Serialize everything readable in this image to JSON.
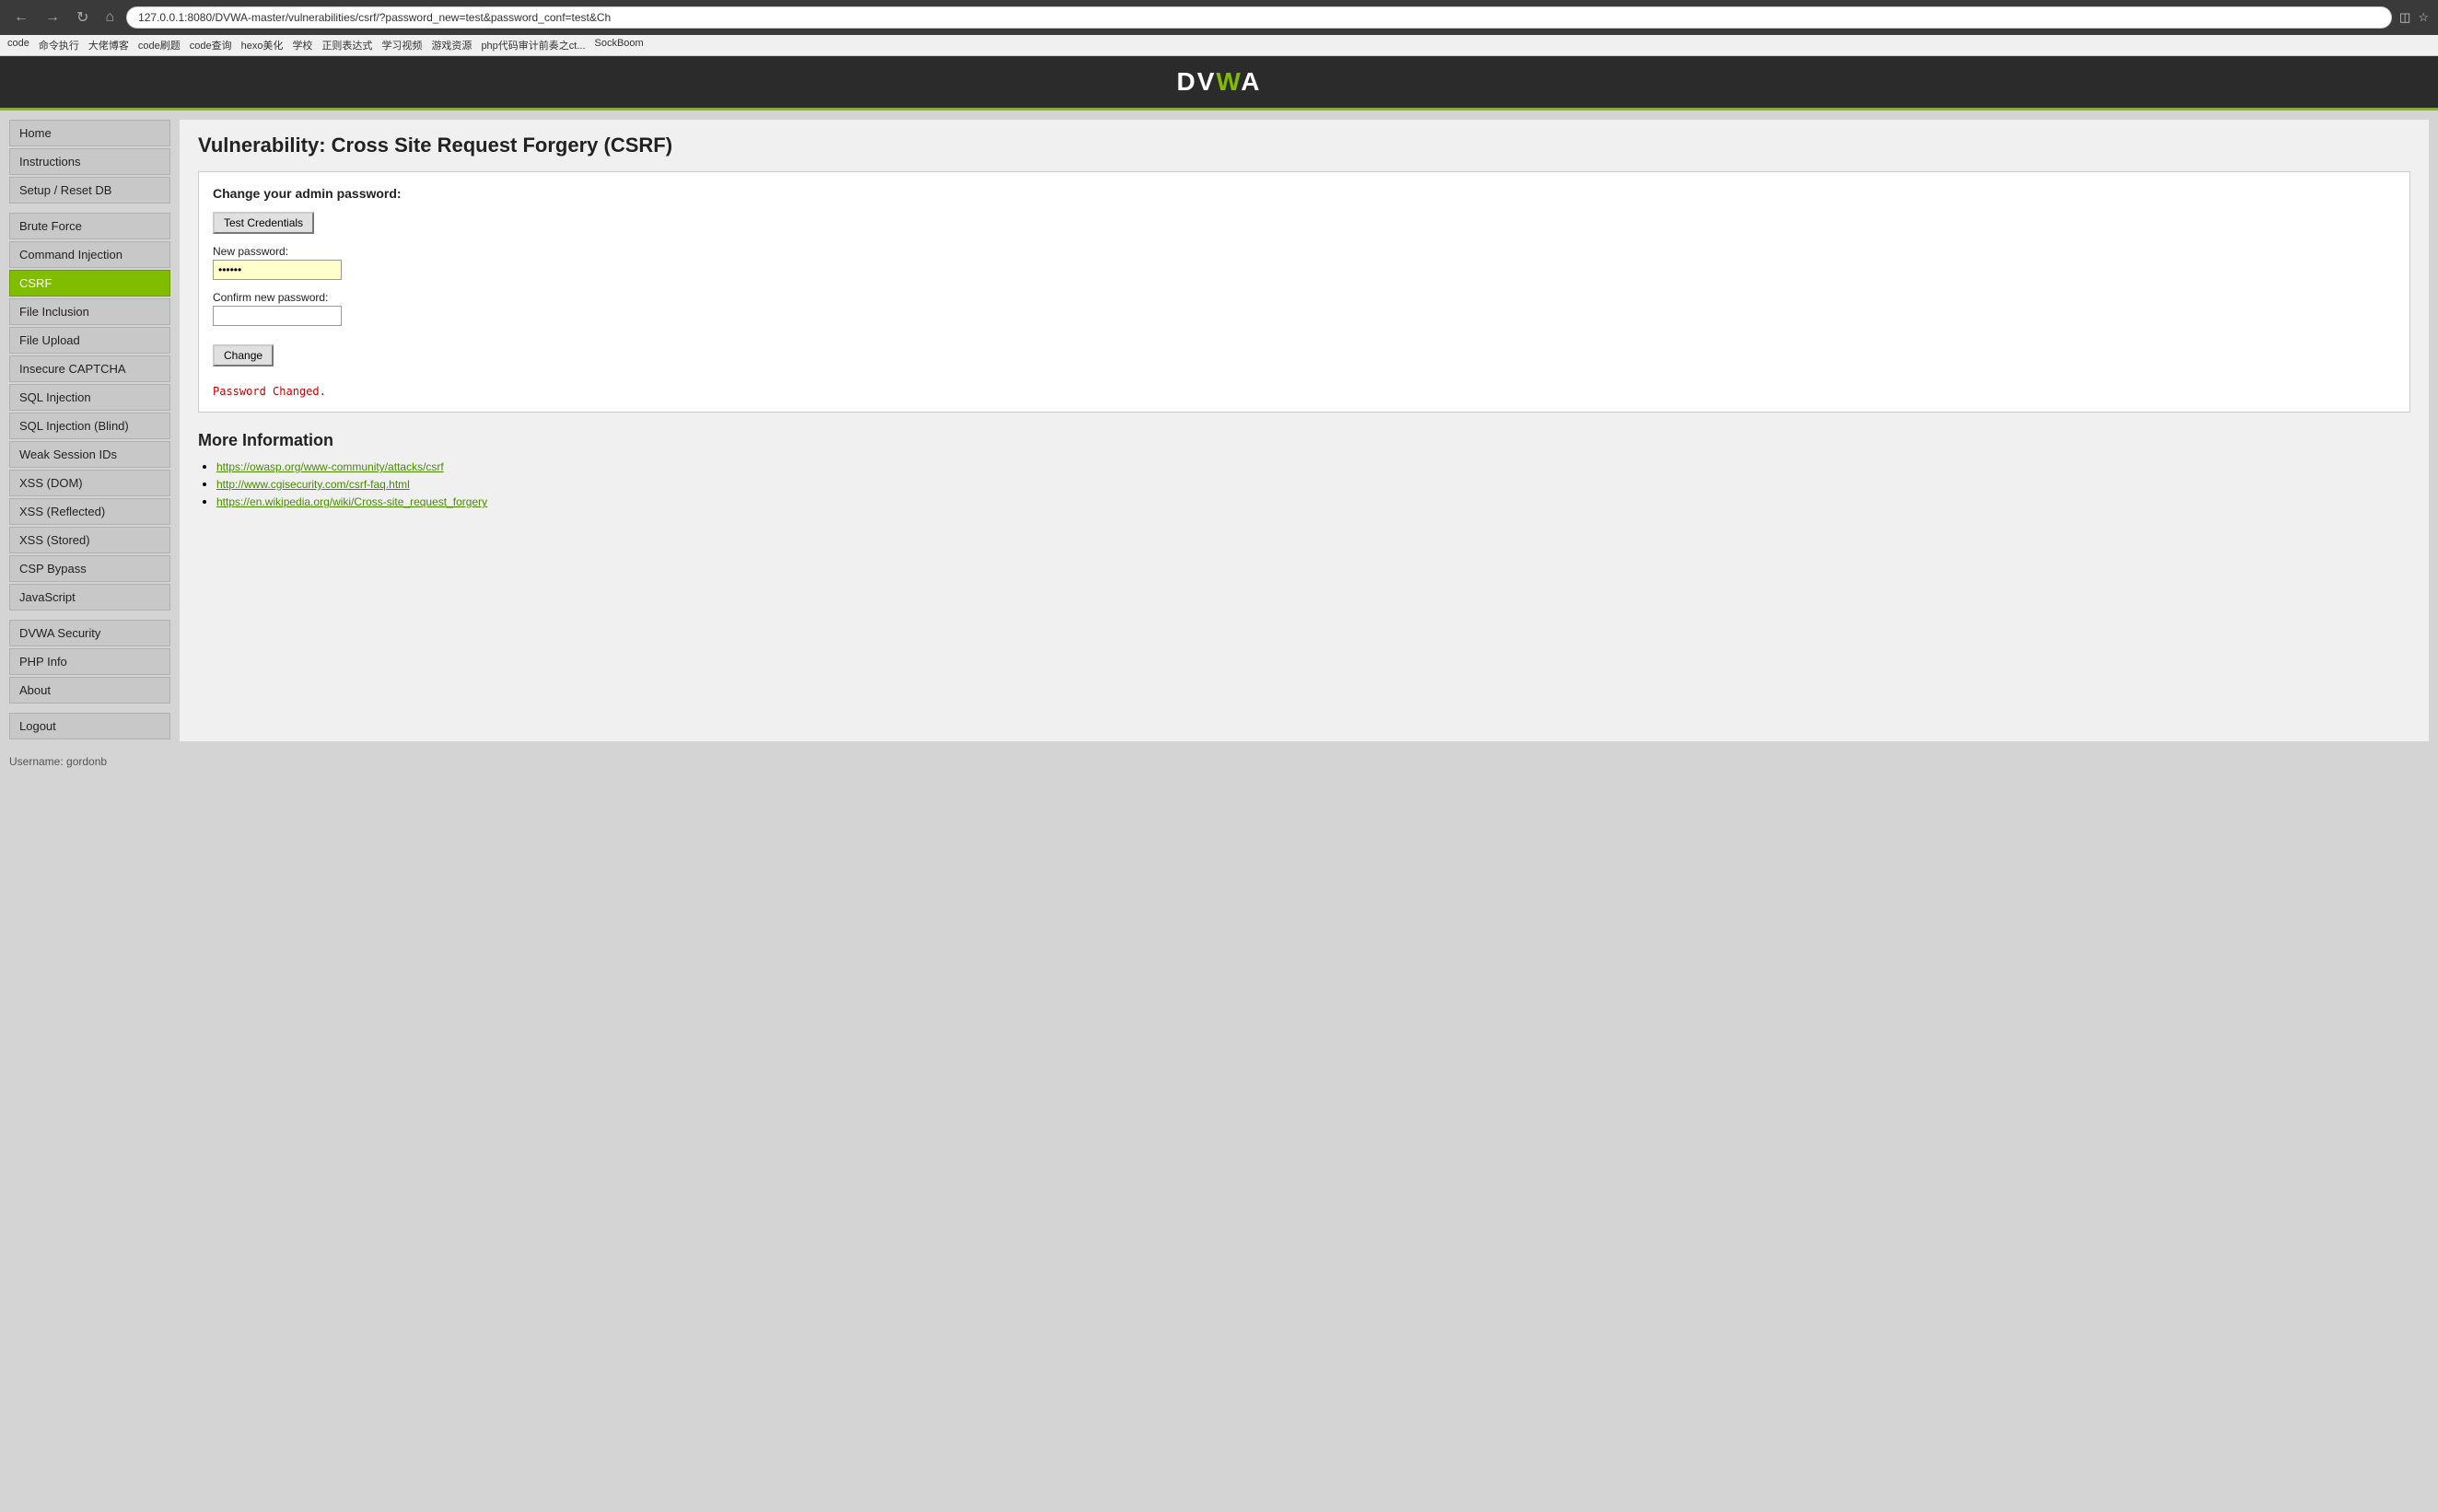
{
  "browser": {
    "url": "127.0.0.1:8080/DVWA-master/vulnerabilities/csrf/?password_new=test&password_conf=test&Ch",
    "nav_back": "←",
    "nav_forward": "→",
    "nav_refresh": "↺",
    "nav_home": "⌂"
  },
  "bookmarks": [
    "code",
    "命令执行",
    "大佬博客",
    "code刷题",
    "code查询",
    "hexo美化",
    "学校",
    "正则表达式",
    "学习视频",
    "游戏资源",
    "php代码审计前奏之ct...",
    "SockBoom"
  ],
  "header": {
    "logo_text": "DVWA"
  },
  "sidebar": {
    "items": [
      {
        "label": "Home",
        "active": false,
        "name": "home"
      },
      {
        "label": "Instructions",
        "active": false,
        "name": "instructions"
      },
      {
        "label": "Setup / Reset DB",
        "active": false,
        "name": "setup-reset-db"
      },
      {
        "label": "Brute Force",
        "active": false,
        "name": "brute-force"
      },
      {
        "label": "Command Injection",
        "active": false,
        "name": "command-injection"
      },
      {
        "label": "CSRF",
        "active": true,
        "name": "csrf"
      },
      {
        "label": "File Inclusion",
        "active": false,
        "name": "file-inclusion"
      },
      {
        "label": "File Upload",
        "active": false,
        "name": "file-upload"
      },
      {
        "label": "Insecure CAPTCHA",
        "active": false,
        "name": "insecure-captcha"
      },
      {
        "label": "SQL Injection",
        "active": false,
        "name": "sql-injection"
      },
      {
        "label": "SQL Injection (Blind)",
        "active": false,
        "name": "sql-injection-blind"
      },
      {
        "label": "Weak Session IDs",
        "active": false,
        "name": "weak-session-ids"
      },
      {
        "label": "XSS (DOM)",
        "active": false,
        "name": "xss-dom"
      },
      {
        "label": "XSS (Reflected)",
        "active": false,
        "name": "xss-reflected"
      },
      {
        "label": "XSS (Stored)",
        "active": false,
        "name": "xss-stored"
      },
      {
        "label": "CSP Bypass",
        "active": false,
        "name": "csp-bypass"
      },
      {
        "label": "JavaScript",
        "active": false,
        "name": "javascript"
      },
      {
        "label": "DVWA Security",
        "active": false,
        "name": "dvwa-security"
      },
      {
        "label": "PHP Info",
        "active": false,
        "name": "php-info"
      },
      {
        "label": "About",
        "active": false,
        "name": "about"
      },
      {
        "label": "Logout",
        "active": false,
        "name": "logout"
      }
    ]
  },
  "content": {
    "page_title": "Vulnerability: Cross Site Request Forgery (CSRF)",
    "form": {
      "heading": "Change your admin password:",
      "test_credentials_btn": "Test Credentials",
      "new_password_label": "New password:",
      "new_password_value": "••••••",
      "confirm_password_label": "Confirm new password:",
      "confirm_password_value": "",
      "change_btn": "Change",
      "success_message": "Password Changed."
    },
    "more_info": {
      "heading": "More Information",
      "links": [
        {
          "text": "https://owasp.org/www-community/attacks/csrf",
          "href": "https://owasp.org/www-community/attacks/csrf"
        },
        {
          "text": "http://www.cgisecurity.com/csrf-faq.html",
          "href": "http://www.cgisecurity.com/csrf-faq.html"
        },
        {
          "text": "https://en.wikipedia.org/wiki/Cross-site_request_forgery",
          "href": "https://en.wikipedia.org/wiki/Cross-site_request_forgery"
        }
      ]
    }
  },
  "footer": {
    "text": "Username: gordonb"
  }
}
